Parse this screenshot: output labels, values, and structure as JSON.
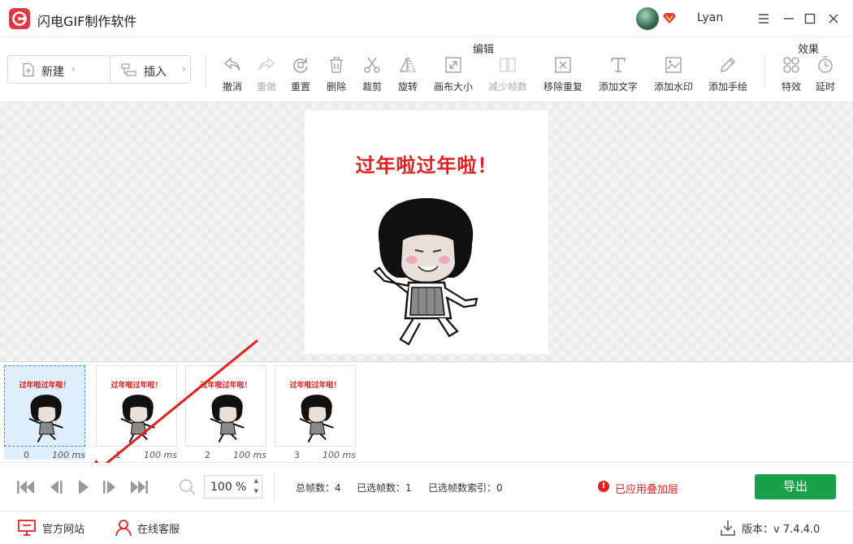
{
  "app": {
    "title": "闪电GIF制作软件",
    "user": "Lyan"
  },
  "toolbar": {
    "new_label": "新建",
    "insert_label": "插入",
    "edit_group_label": "编辑",
    "effects_group_label": "效果",
    "tools": [
      {
        "label": "撤消",
        "icon": "undo-icon",
        "enabled": true
      },
      {
        "label": "重做",
        "icon": "redo-icon",
        "enabled": false
      },
      {
        "label": "重置",
        "icon": "reset-icon",
        "enabled": true
      },
      {
        "label": "删除",
        "icon": "delete-icon",
        "enabled": true
      },
      {
        "label": "裁剪",
        "icon": "crop-icon",
        "enabled": true
      },
      {
        "label": "旋转",
        "icon": "rotate-icon",
        "enabled": true
      },
      {
        "label": "画布大小",
        "icon": "canvas-size-icon",
        "enabled": true
      },
      {
        "label": "减少帧数",
        "icon": "reduce-frames-icon",
        "enabled": false
      },
      {
        "label": "移除重复",
        "icon": "remove-duplicate-icon",
        "enabled": true
      },
      {
        "label": "添加文字",
        "icon": "add-text-icon",
        "enabled": true
      },
      {
        "label": "添加水印",
        "icon": "add-watermark-icon",
        "enabled": true
      },
      {
        "label": "添加手绘",
        "icon": "add-drawing-icon",
        "enabled": true
      }
    ],
    "effects": [
      {
        "label": "特效",
        "icon": "effects-icon"
      },
      {
        "label": "延时",
        "icon": "delay-icon"
      }
    ]
  },
  "preview": {
    "caption": "过年啦过年啦！"
  },
  "frames": [
    {
      "index": "0",
      "duration": "100 ms",
      "caption": "过年啦过年啦！",
      "selected": true
    },
    {
      "index": "1",
      "duration": "100 ms",
      "caption": "过年啦过年啦！",
      "selected": false
    },
    {
      "index": "2",
      "duration": "100 ms",
      "caption": "过年啦过年啦！",
      "selected": false
    },
    {
      "index": "3",
      "duration": "100 ms",
      "caption": "过年啦过年啦！",
      "selected": false
    }
  ],
  "playback": {
    "zoom_value": "100",
    "zoom_unit": "%",
    "total_frames": "总帧数：4",
    "selected_frames": "已选帧数：1",
    "selected_index": "已选帧数索引：0",
    "layer_status": "已应用叠加层",
    "export_label": "导出"
  },
  "statusbar": {
    "website_label": "官方网站",
    "support_label": "在线客服",
    "version_label": "版本：v 7.4.4.0"
  },
  "colors": {
    "accent_red": "#e02020",
    "export_green": "#1aa04a",
    "selection_blue": "#3a8fd8"
  }
}
